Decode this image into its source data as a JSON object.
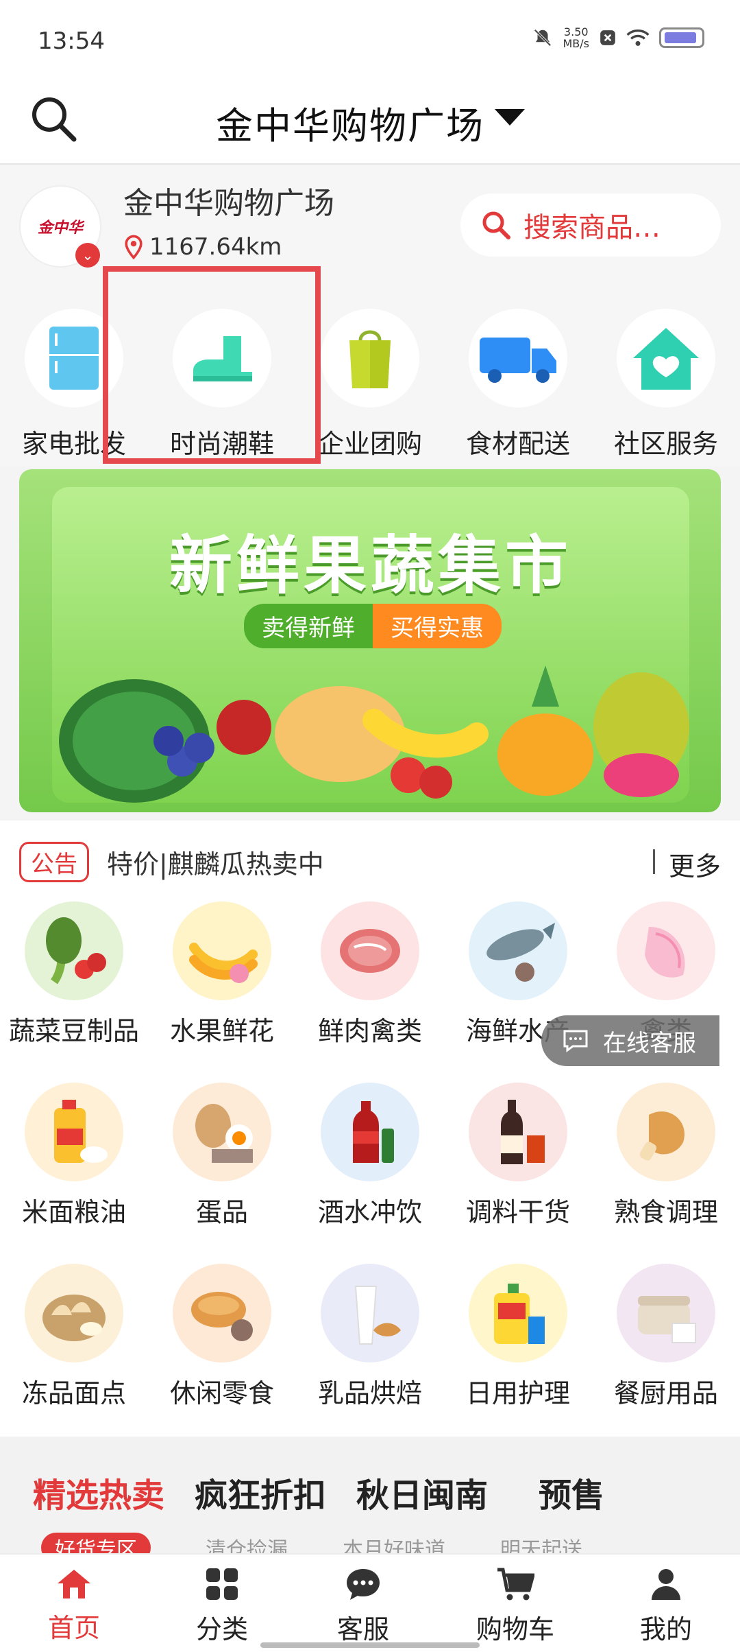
{
  "status_bar": {
    "time": "13:54",
    "net_speed": "3.50",
    "net_unit": "MB/s"
  },
  "header": {
    "title": "金中华购物广场"
  },
  "store": {
    "logo_text": "金中华",
    "name": "金中华购物广场",
    "distance": "1167.64km",
    "search_placeholder": "搜索商品…"
  },
  "quick_nav": [
    {
      "label": "家电批发",
      "icon": "fridge-icon"
    },
    {
      "label": "时尚潮鞋",
      "icon": "boot-icon"
    },
    {
      "label": "企业团购",
      "icon": "shopping-bag-icon"
    },
    {
      "label": "食材配送",
      "icon": "truck-icon"
    },
    {
      "label": "社区服务",
      "icon": "house-heart-icon"
    }
  ],
  "banner": {
    "title": "新鲜果蔬集市",
    "tag_a": "卖得新鲜",
    "tag_b": "买得实惠"
  },
  "notice": {
    "badge": "公告",
    "text": "特价|麒麟瓜热卖中",
    "more": "更多"
  },
  "categories": [
    {
      "label": "蔬菜豆制品",
      "color": "#e4f3d6"
    },
    {
      "label": "水果鲜花",
      "color": "#fff3c8"
    },
    {
      "label": "鲜肉禽类",
      "color": "#fde3e3"
    },
    {
      "label": "海鲜水产",
      "color": "#e2f1fa"
    },
    {
      "label": "禽类",
      "color": "#fde8ea"
    },
    {
      "label": "米面粮油",
      "color": "#fff0d6"
    },
    {
      "label": "蛋品",
      "color": "#fdebd8"
    },
    {
      "label": "酒水冲饮",
      "color": "#e3eefb"
    },
    {
      "label": "调料干货",
      "color": "#fbe4e4"
    },
    {
      "label": "熟食调理",
      "color": "#fdecd6"
    },
    {
      "label": "冻品面点",
      "color": "#fdf0d8"
    },
    {
      "label": "休闲零食",
      "color": "#fde9d6"
    },
    {
      "label": "乳品烘焙",
      "color": "#e9ecf8"
    },
    {
      "label": "日用护理",
      "color": "#fff6cc"
    },
    {
      "label": "餐厨用品",
      "color": "#f3e6f3"
    }
  ],
  "cs_float": {
    "label": "在线客服"
  },
  "promo": {
    "tabs": [
      "精选热卖",
      "疯狂折扣",
      "秋日闽南",
      "预售"
    ],
    "subs": [
      "好货专区",
      "清仓捡漏",
      "本月好味道",
      "明天起送"
    ]
  },
  "bottom_nav": [
    {
      "label": "首页",
      "icon": "home-icon"
    },
    {
      "label": "分类",
      "icon": "grid-icon"
    },
    {
      "label": "客服",
      "icon": "chat-icon"
    },
    {
      "label": "购物车",
      "icon": "cart-icon"
    },
    {
      "label": "我的",
      "icon": "user-icon"
    }
  ],
  "colors": {
    "accent": "#e23a3a",
    "banner_green": "#7fd34f"
  }
}
